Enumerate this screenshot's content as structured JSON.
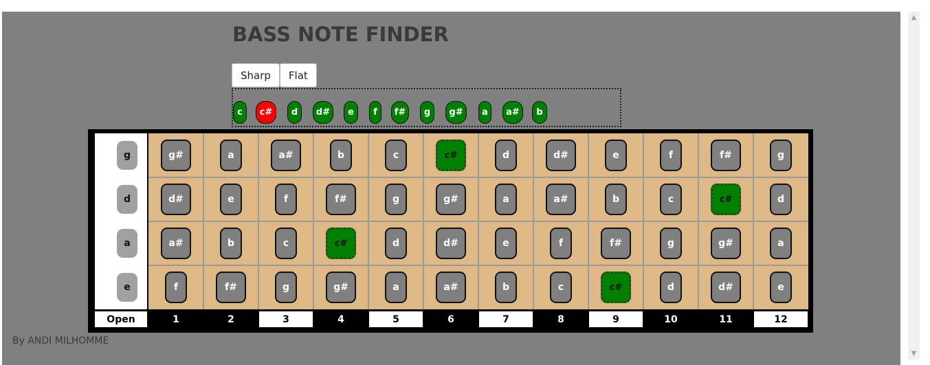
{
  "header": {
    "title": "BASS NOTE FINDER"
  },
  "mode": {
    "sharp_label": "Sharp",
    "flat_label": "Flat",
    "selected": "Sharp"
  },
  "picker": {
    "notes": [
      "c",
      "c#",
      "d",
      "d#",
      "e",
      "f",
      "f#",
      "g",
      "g#",
      "a",
      "a#",
      "b"
    ],
    "selected": "c#"
  },
  "fretboard": {
    "strings": [
      {
        "name": "g",
        "frets": [
          "g#",
          "a",
          "a#",
          "b",
          "c",
          "c#",
          "d",
          "d#",
          "e",
          "f",
          "f#",
          "g"
        ]
      },
      {
        "name": "d",
        "frets": [
          "d#",
          "e",
          "f",
          "f#",
          "g",
          "g#",
          "a",
          "a#",
          "b",
          "c",
          "c#",
          "d"
        ]
      },
      {
        "name": "a",
        "frets": [
          "a#",
          "b",
          "c",
          "c#",
          "d",
          "d#",
          "e",
          "f",
          "f#",
          "g",
          "g#",
          "a"
        ]
      },
      {
        "name": "e",
        "frets": [
          "f",
          "f#",
          "g",
          "g#",
          "a",
          "a#",
          "b",
          "c",
          "c#",
          "d",
          "d#",
          "e"
        ]
      }
    ],
    "highlighted_note": "c#",
    "open_label": "Open",
    "fret_numbers": [
      "1",
      "2",
      "3",
      "4",
      "5",
      "6",
      "7",
      "8",
      "9",
      "10",
      "11",
      "12"
    ],
    "marker_frets": [
      "3",
      "5",
      "7",
      "9",
      "12"
    ]
  },
  "footer": {
    "credit": "By ANDI MILHOMME"
  },
  "colors": {
    "page_bg": "#808080",
    "fretboard": "#deb887",
    "note_default": "#808080",
    "note_highlight": "#008000",
    "picker_selected": "#ff0000",
    "picker_default": "#008000"
  }
}
